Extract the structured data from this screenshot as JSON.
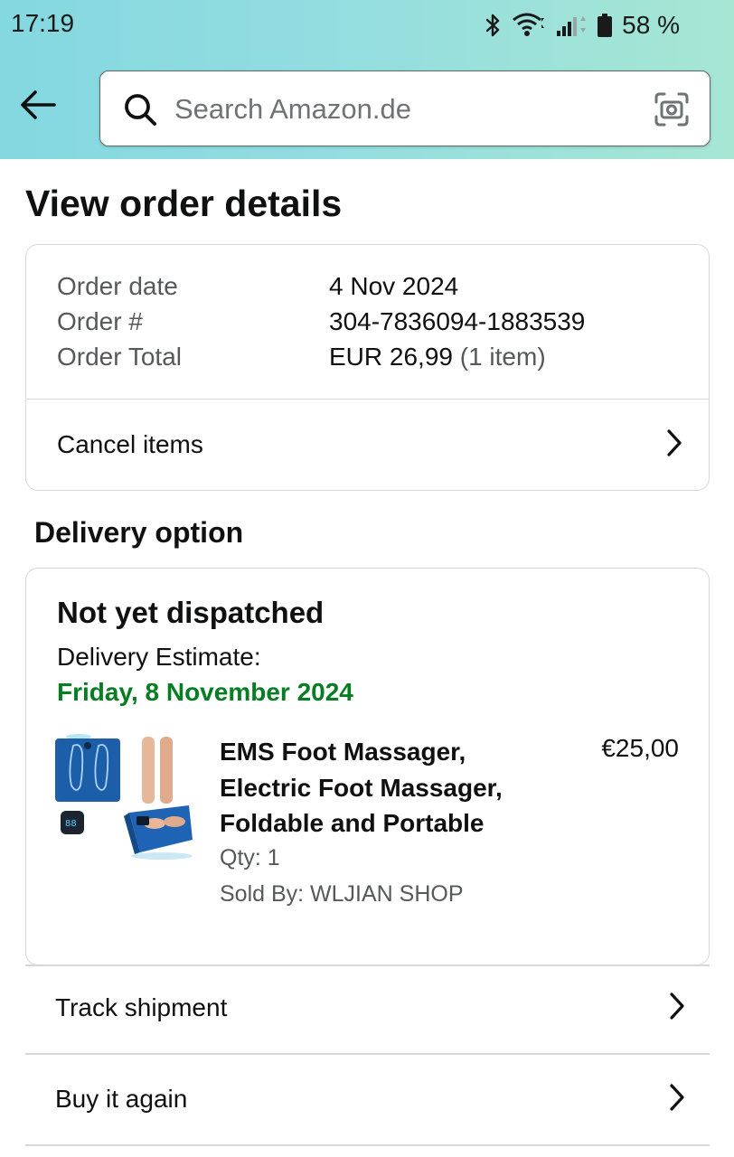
{
  "status_bar": {
    "time": "17:19",
    "battery_percent": "58 %",
    "icons": [
      "bluetooth-icon",
      "wifi-icon",
      "cellular-signal-icon",
      "battery-icon"
    ]
  },
  "header": {
    "back_icon": "arrow-left-icon",
    "search_placeholder": "Search Amazon.de",
    "search_value": "",
    "search_icon": "search-icon",
    "camera_icon": "camera-lens-icon",
    "gradient_colors": [
      "#84d8e0",
      "#a6e6d3"
    ]
  },
  "page": {
    "title": "View order details"
  },
  "order_summary": {
    "rows": [
      {
        "label": "Order date",
        "value": "4 Nov 2024"
      },
      {
        "label": "Order #",
        "value": "304-7836094-1883539"
      },
      {
        "label": "Order Total",
        "value": "EUR 26,99",
        "value_suffix": "(1 item)"
      }
    ],
    "cancel_label": "Cancel items"
  },
  "delivery": {
    "section_title": "Delivery option",
    "status": "Not yet dispatched",
    "estimate_label": "Delivery Estimate:",
    "estimate_date": "Friday, 8 November 2024",
    "estimate_color": "#067d22",
    "product": {
      "title_lines": [
        "EMS Foot Massager,",
        "Electric Foot Massager,",
        "Foldable and Portable"
      ],
      "price": "€25,00",
      "quantity": "Qty: 1",
      "seller": "Sold By: WLJIAN SHOP",
      "image": "foot-massager-product-image"
    }
  },
  "actions": [
    {
      "label": "Track shipment"
    },
    {
      "label": "Buy it again"
    }
  ]
}
